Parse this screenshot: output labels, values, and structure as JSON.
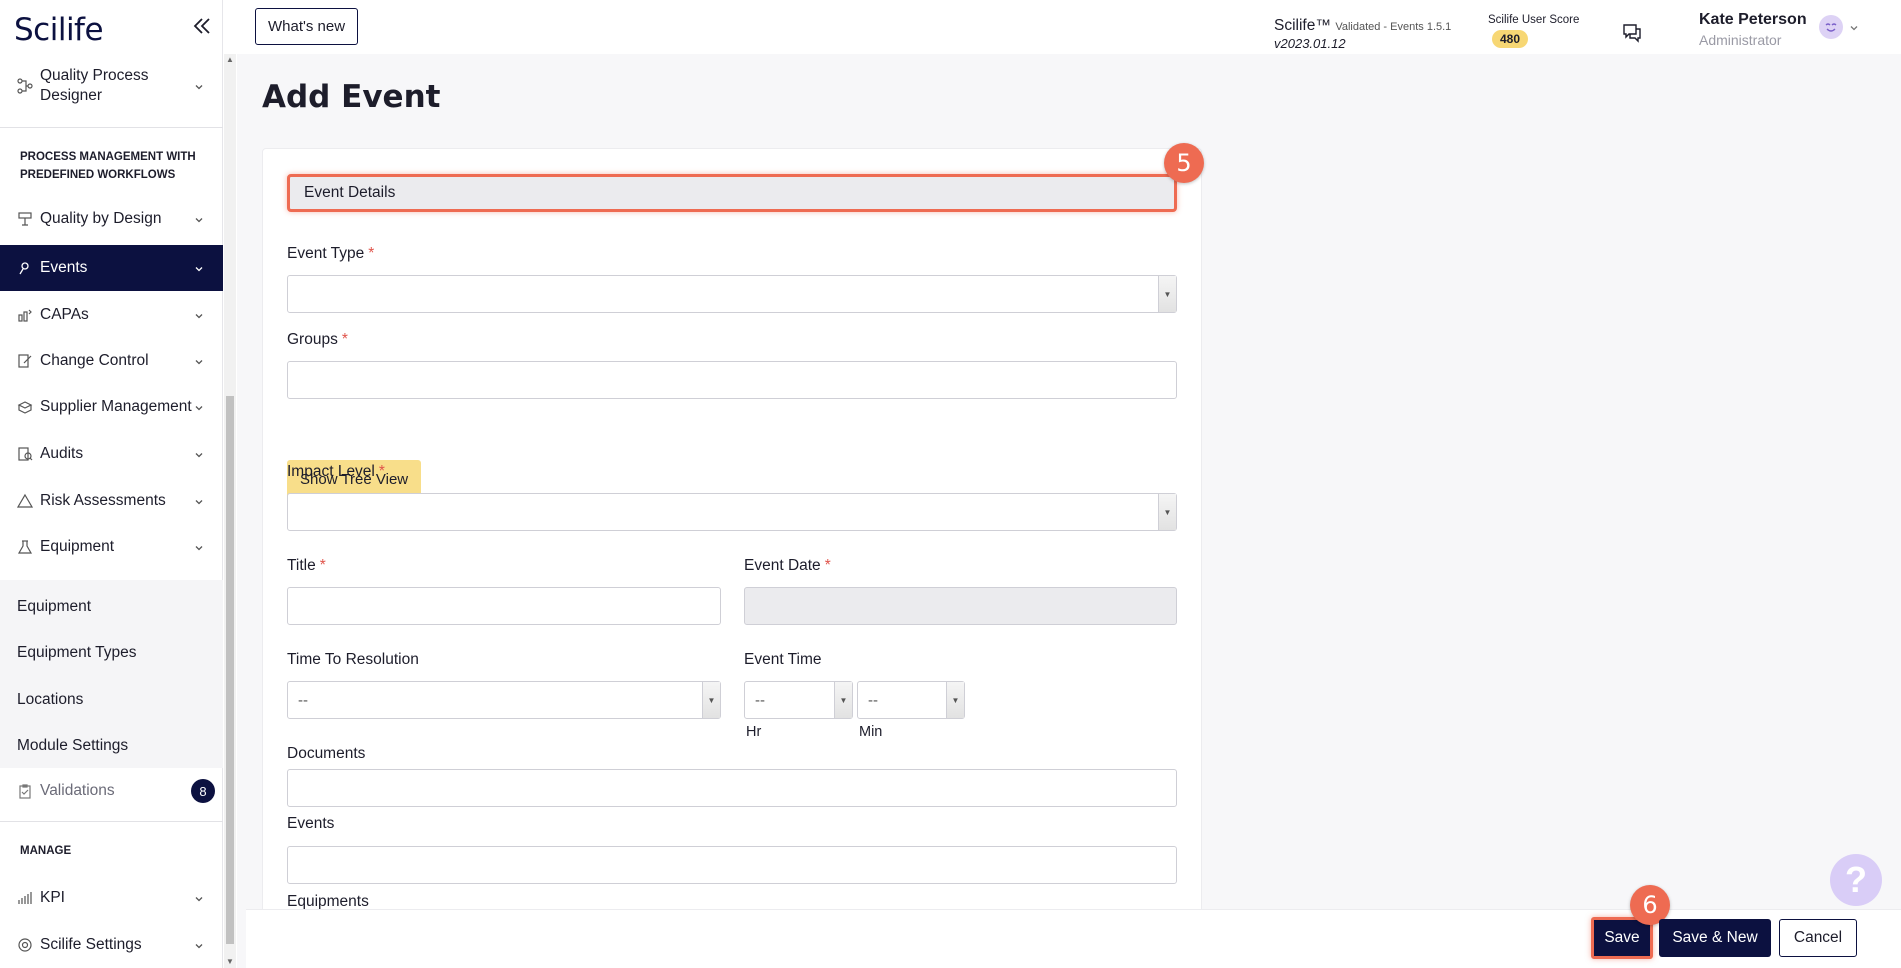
{
  "app": {
    "logo": "Scilife",
    "whats_new": "What's new",
    "brand": "Scilife™",
    "validated": "Validated - Events 1.5.1",
    "version": "v2023.01.12",
    "score_label": "Scilife User Score",
    "score_value": "480",
    "user_name": "Kate Peterson",
    "user_role": "Administrator",
    "help": "?"
  },
  "sidebar": {
    "quality_process_designer": "Quality Process Designer",
    "section_pm": "PROCESS MANAGEMENT WITH PREDEFINED WORKFLOWS",
    "items": [
      {
        "label": "Quality by Design",
        "icon": "design-icon"
      },
      {
        "label": "Events",
        "icon": "pin-icon"
      },
      {
        "label": "CAPAs",
        "icon": "capa-icon"
      },
      {
        "label": "Change Control",
        "icon": "change-icon"
      },
      {
        "label": "Supplier Management",
        "icon": "supplier-icon"
      },
      {
        "label": "Audits",
        "icon": "audit-icon"
      },
      {
        "label": "Risk Assessments",
        "icon": "warning-icon"
      },
      {
        "label": "Equipment",
        "icon": "flask-icon"
      }
    ],
    "sub_items": [
      "Equipment",
      "Equipment Types",
      "Locations",
      "Module Settings"
    ],
    "validations": "Validations",
    "validations_badge": "8",
    "section_manage": "MANAGE",
    "kpi": "KPI",
    "scilife_settings": "Scilife Settings"
  },
  "form": {
    "page_title": "Add Event",
    "section_title": "Event Details",
    "event_type_label": "Event Type",
    "groups_label": "Groups",
    "show_tree_view": "Show Tree View",
    "impact_level_label": "Impact Level",
    "title_label": "Title",
    "event_date_label": "Event Date",
    "time_to_resolution_label": "Time To Resolution",
    "time_to_resolution_value": "--",
    "event_time_label": "Event Time",
    "hour_value": "--",
    "minute_value": "--",
    "hr_label": "Hr",
    "min_label": "Min",
    "documents_label": "Documents",
    "events_label": "Events",
    "equipments_label": "Equipments",
    "required_mark": "*"
  },
  "annotations": {
    "step5": "5",
    "step6": "6"
  },
  "actions": {
    "save": "Save",
    "save_new": "Save & New",
    "cancel": "Cancel"
  }
}
